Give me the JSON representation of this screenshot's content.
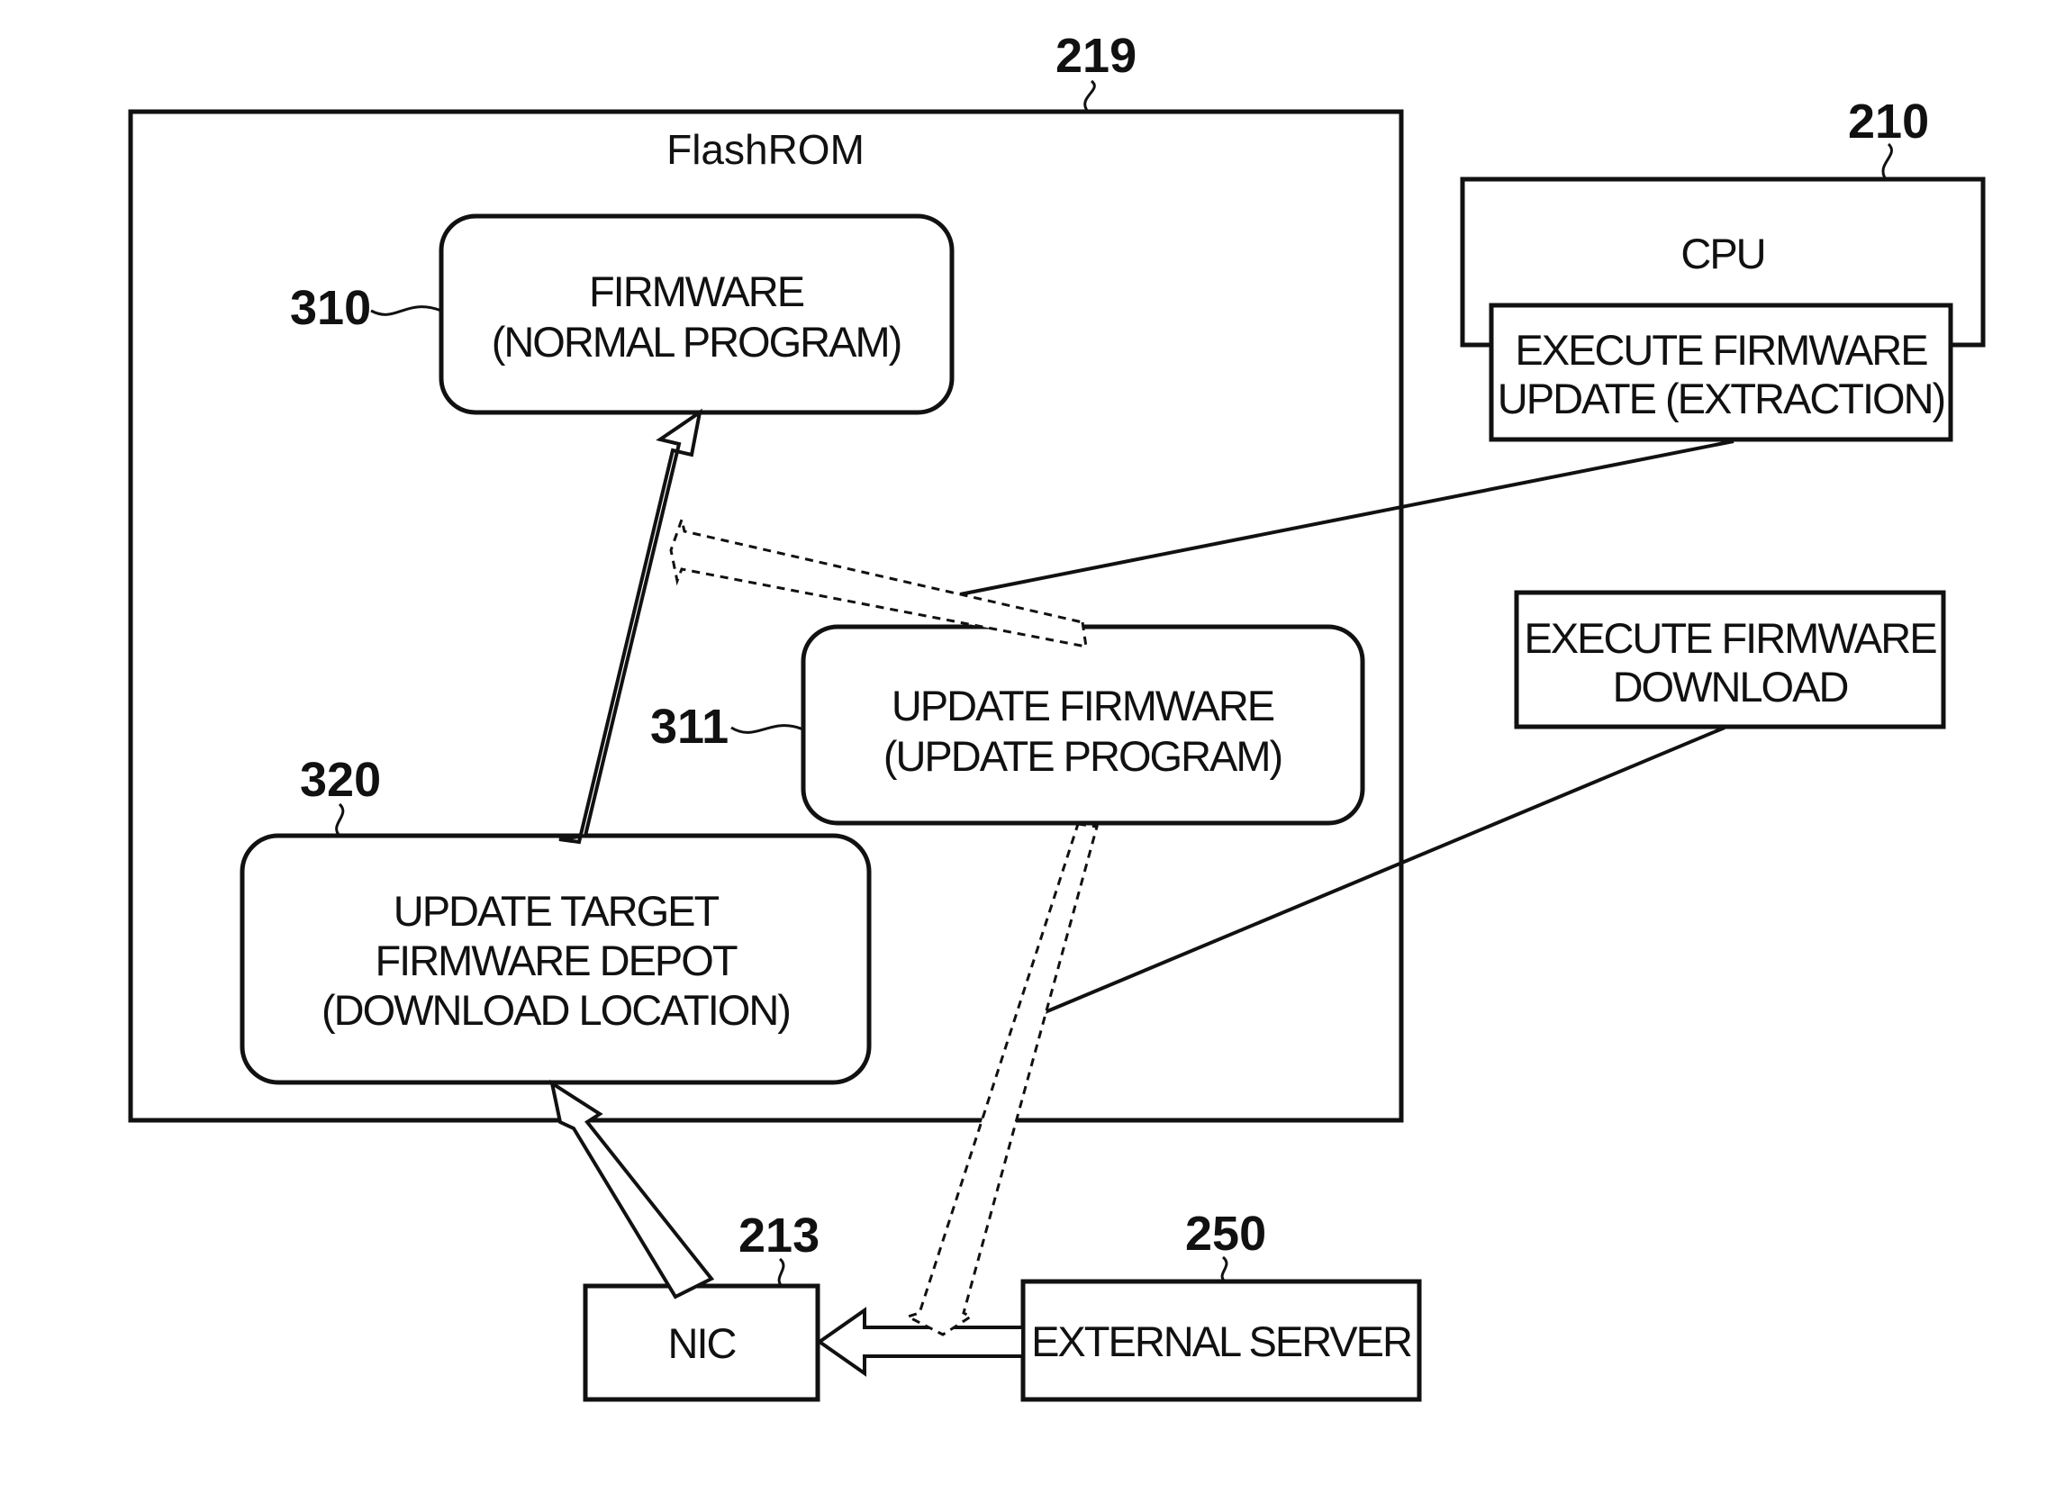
{
  "figure": {
    "flashrom": {
      "ref": "219",
      "label": "FlashROM"
    },
    "firmware": {
      "ref": "310",
      "lines": [
        "FIRMWARE",
        "(NORMAL PROGRAM)"
      ]
    },
    "update_firmware": {
      "ref": "311",
      "lines": [
        "UPDATE FIRMWARE",
        "(UPDATE PROGRAM)"
      ]
    },
    "depot": {
      "ref": "320",
      "lines": [
        "UPDATE TARGET",
        "FIRMWARE DEPOT",
        "(DOWNLOAD LOCATION)"
      ]
    },
    "cpu": {
      "ref": "210",
      "label": "CPU"
    },
    "execute_update": {
      "lines": [
        "EXECUTE FIRMWARE",
        "UPDATE (EXTRACTION)"
      ]
    },
    "execute_download": {
      "lines": [
        "EXECUTE FIRMWARE",
        "DOWNLOAD"
      ]
    },
    "nic": {
      "ref": "213",
      "label": "NIC"
    },
    "external_server": {
      "ref": "250",
      "label": "EXTERNAL SERVER"
    }
  }
}
